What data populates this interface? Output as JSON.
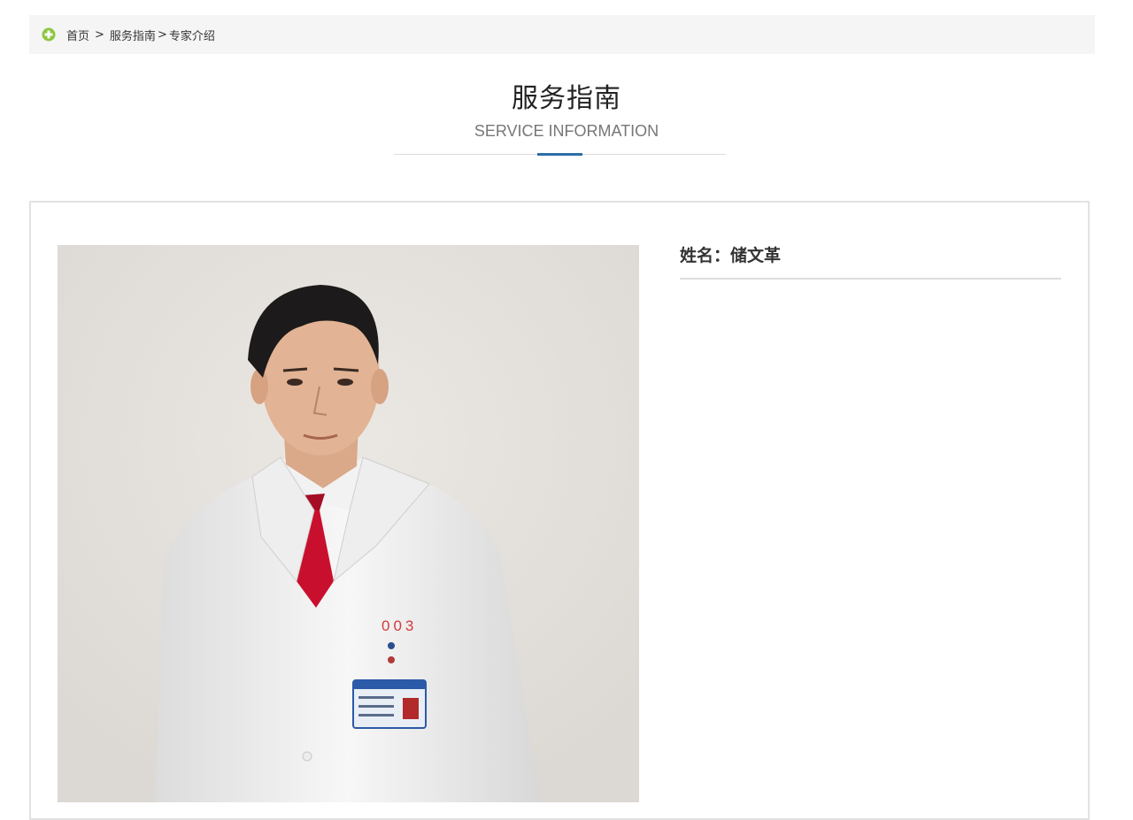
{
  "breadcrumb": {
    "home": "首页",
    "sep": ">",
    "section": "服务指南",
    "current": "专家介绍"
  },
  "header": {
    "title": "服务指南",
    "subtitle": "SERVICE INFORMATION"
  },
  "profile": {
    "name_label": "姓名：储文革",
    "badge_number": "003"
  },
  "colors": {
    "accent": "#2b6ea8",
    "icon_green": "#8cc63f"
  }
}
